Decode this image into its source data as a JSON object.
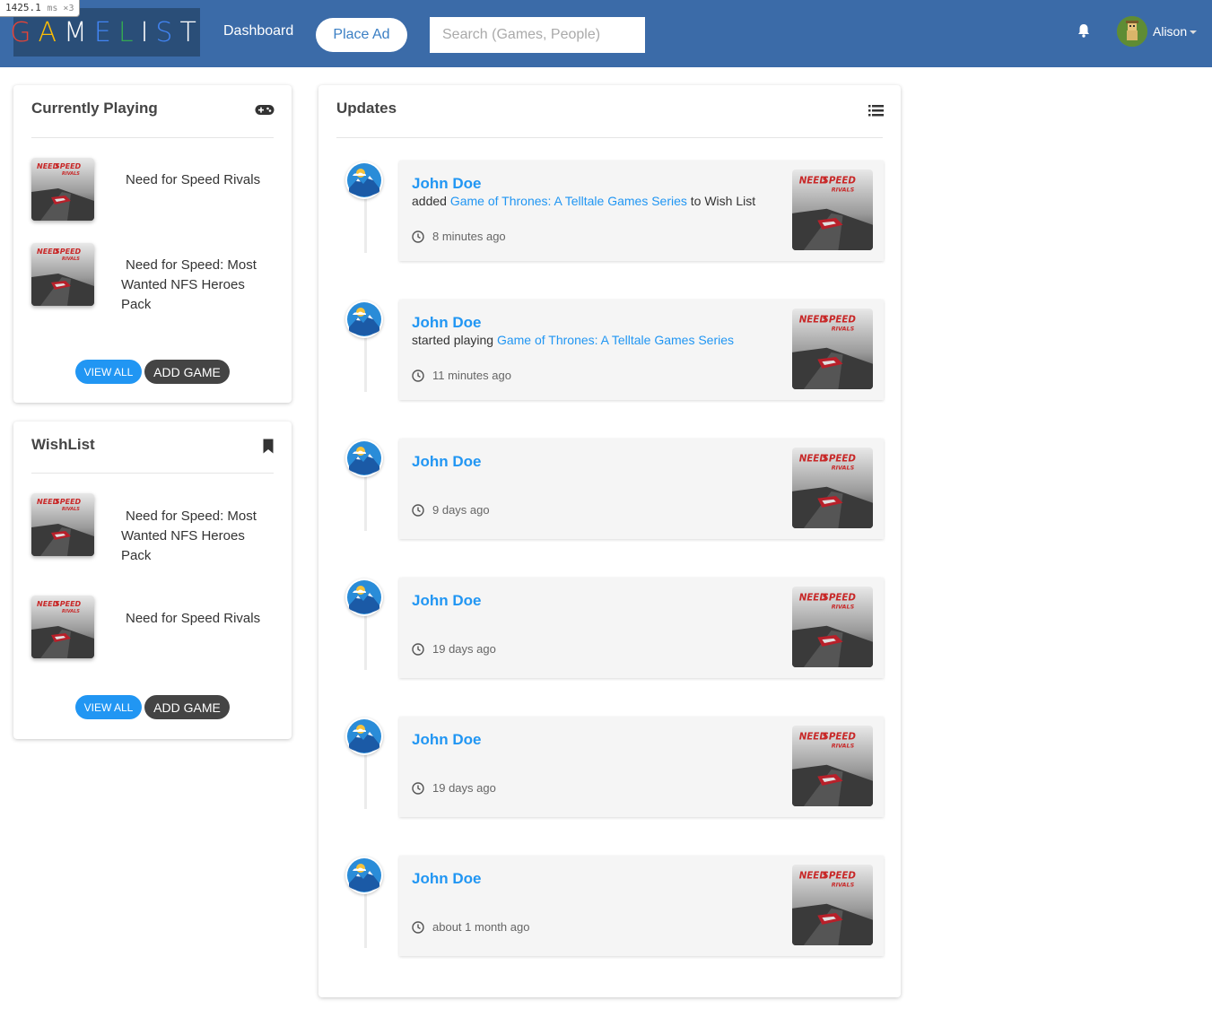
{
  "perf": {
    "value": "1425.1",
    "unit": "ms ×3"
  },
  "brand": {
    "letters": [
      "G",
      "A",
      "M",
      "E",
      "L",
      "I",
      "S",
      "T"
    ],
    "colors": [
      "#ea4335",
      "#fbbc05",
      "#ffffff",
      "#4285f4",
      "#34a853",
      "#ffffff",
      "#4285f4",
      "#ffffff"
    ]
  },
  "nav": {
    "dashboard": "Dashboard",
    "place_ad": "Place Ad",
    "search_placeholder": "Search (Games, People)",
    "user_name": "Alison"
  },
  "currently_playing": {
    "title": "Currently Playing",
    "games": [
      "Need for Speed Rivals",
      "Need for Speed: Most Wanted NFS Heroes Pack"
    ],
    "view_all": "VIEW ALL",
    "add_game": "ADD GAME"
  },
  "wishlist": {
    "title": "WishList",
    "games": [
      "Need for Speed: Most Wanted NFS Heroes Pack",
      "Need for Speed Rivals"
    ],
    "view_all": "VIEW ALL",
    "add_game": "ADD GAME"
  },
  "updates": {
    "title": "Updates",
    "items": [
      {
        "user": "John Doe",
        "pre": "added",
        "link": "Game of Thrones: A Telltale Games Series",
        "post": "to Wish List",
        "time": "8 minutes ago"
      },
      {
        "user": "John Doe",
        "pre": "started playing",
        "link": "Game of Thrones: A Telltale Games Series",
        "post": "",
        "time": "11 minutes ago"
      },
      {
        "user": "John Doe",
        "pre": "",
        "link": "",
        "post": "",
        "time": "9 days ago"
      },
      {
        "user": "John Doe",
        "pre": "",
        "link": "",
        "post": "",
        "time": "19 days ago"
      },
      {
        "user": "John Doe",
        "pre": "",
        "link": "",
        "post": "",
        "time": "19 days ago"
      },
      {
        "user": "John Doe",
        "pre": "",
        "link": "",
        "post": "",
        "time": "about 1 month ago"
      }
    ]
  },
  "colors": {
    "navbar": "#3b6ba8",
    "accent": "#2196f3",
    "dark_button": "#444444"
  },
  "icons": {
    "controller": "gamepad-icon",
    "bookmark": "bookmark-icon",
    "list": "list-icon",
    "bell": "bell-icon",
    "clock": "clock-icon"
  }
}
